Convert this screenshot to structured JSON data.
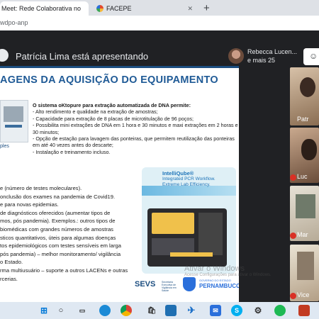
{
  "browser": {
    "tabs": [
      {
        "title": "Meet: Rede Colaborativa no",
        "active": true
      },
      {
        "title": "FACEPE",
        "active": false
      }
    ],
    "new_tab_label": "+",
    "url": "wdpo-anp"
  },
  "meet": {
    "presenter_text": "Patrícia Lima está apresentando",
    "top_participant_name": "Rebecca Lucen...",
    "top_participant_more": "e mais 25",
    "tiles": [
      {
        "label": "Patr"
      },
      {
        "label": "Luc"
      },
      {
        "label": "Mar"
      },
      {
        "label": "Vice"
      }
    ]
  },
  "slide": {
    "title": "AGENS DA AQUISIÇÃO DO EQUIPAMENTO",
    "intro_bold": "O sistema oKtopure para extração automatizada de DNA permite:",
    "right_bullets": [
      "- Alto rendimento e qualidade na extração de amostras;",
      "- Capacidade para extração de 8 placas de microtitulação de 96 poços;",
      "- Possibilita mini extrações de DNA em 1 hora e 30 minutos e maxi extrações em 2 horas e 30 minutos;",
      "- Opção de estação para lavagem das ponteiras, que permitem reutilização das ponteiras em até 40 vezes antes do descarte;",
      "- Instalação e treinamento incluso."
    ],
    "small_image_caption": "ples",
    "left_lines": [
      "e (número de testes moleculares).",
      "onclusão dos exames na pandemia de Covid19.",
      "e para novas epidemias.",
      " de diagnósticos oferecidos (aumentar tipos de",
      "mos, pós pandemia). Exemplos.: outros tipos de",
      "",
      " biomédicas com grandes números de amostras",
      "sticos quantitativos, úteis para algumas doenças",
      "tos epidemiológicos com testes sensíveis em larga",
      "pós pandemia) – melhor monitoramento/ vigilância",
      "o Estado.",
      "rma multiusuário – suporte a outros LACENs e outras",
      "rcerias."
    ],
    "product_name": "IntelliQube®",
    "product_sub1": "Integrated PCR Workflow.",
    "product_sub2": "Extreme Lab Efficiency.",
    "logo_sevs": "SEVS",
    "logo_sevs_sub": "Secretaria Executiva de Vigilância em Saúde",
    "logo_pe": "PERNAMBUCO",
    "logo_pe_top": "GOVERNO DO ESTADO",
    "watermark1": "Ativar o Windows",
    "watermark2": "Acesse Configurações para ativar o Windows."
  },
  "taskbar": {
    "icons": [
      "windows-icon",
      "search-icon",
      "taskview-icon",
      "edge-icon",
      "chrome-icon",
      "store-icon",
      "photos-icon",
      "email-icon",
      "skype-icon",
      "settings-icon",
      "spotify-icon",
      "misc-icon"
    ]
  },
  "colors": {
    "accent": "#1c4e80",
    "title_blue": "#1f5a96",
    "meet_bg": "#202124",
    "mic_red": "#d93025"
  }
}
